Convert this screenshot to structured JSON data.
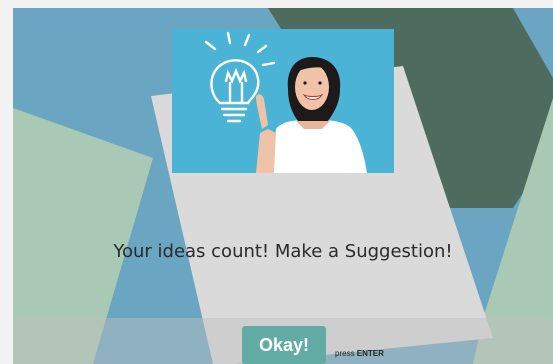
{
  "slide": {
    "message": "Your ideas count! Make a Suggestion!",
    "hero_image": "woman-with-lightbulb-idea"
  },
  "controls": {
    "okay_label": "Okay!",
    "hint_prefix": "press",
    "hint_key": "ENTER"
  },
  "colors": {
    "background_blue": "#6aa6c1",
    "panel_green_light": "#a9c9b4",
    "panel_green_dark": "#4d6b5e",
    "center_card": "#dadada",
    "button": "#63aca5",
    "hero_bg": "#4bb4d6"
  }
}
